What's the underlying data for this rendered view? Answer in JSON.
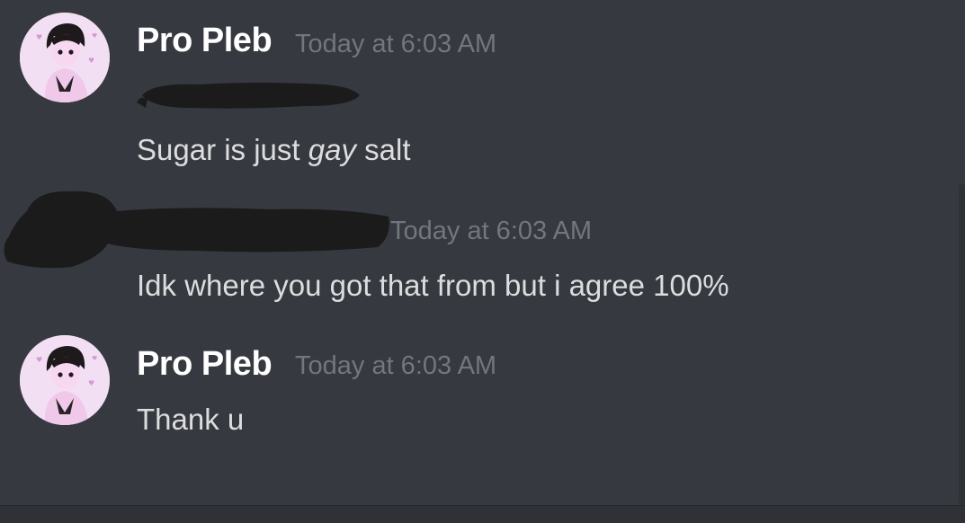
{
  "messages": [
    {
      "author": "Pro Pleb",
      "timestamp": "Today at 6:03 AM",
      "lines": [
        {
          "text_before": "Sugar is just ",
          "emphasis": "gay",
          "text_after": " salt"
        }
      ]
    },
    {
      "author": "",
      "timestamp": "Today at 6:03 AM",
      "lines": [
        {
          "text": "Idk where you got that from but i agree 100%"
        }
      ]
    },
    {
      "author": "Pro Pleb",
      "timestamp": "Today at 6:03 AM",
      "lines": [
        {
          "text": "Thank u"
        }
      ]
    }
  ],
  "avatar_icon": "user-avatar-icon",
  "redaction_color": "#1b1b1c"
}
